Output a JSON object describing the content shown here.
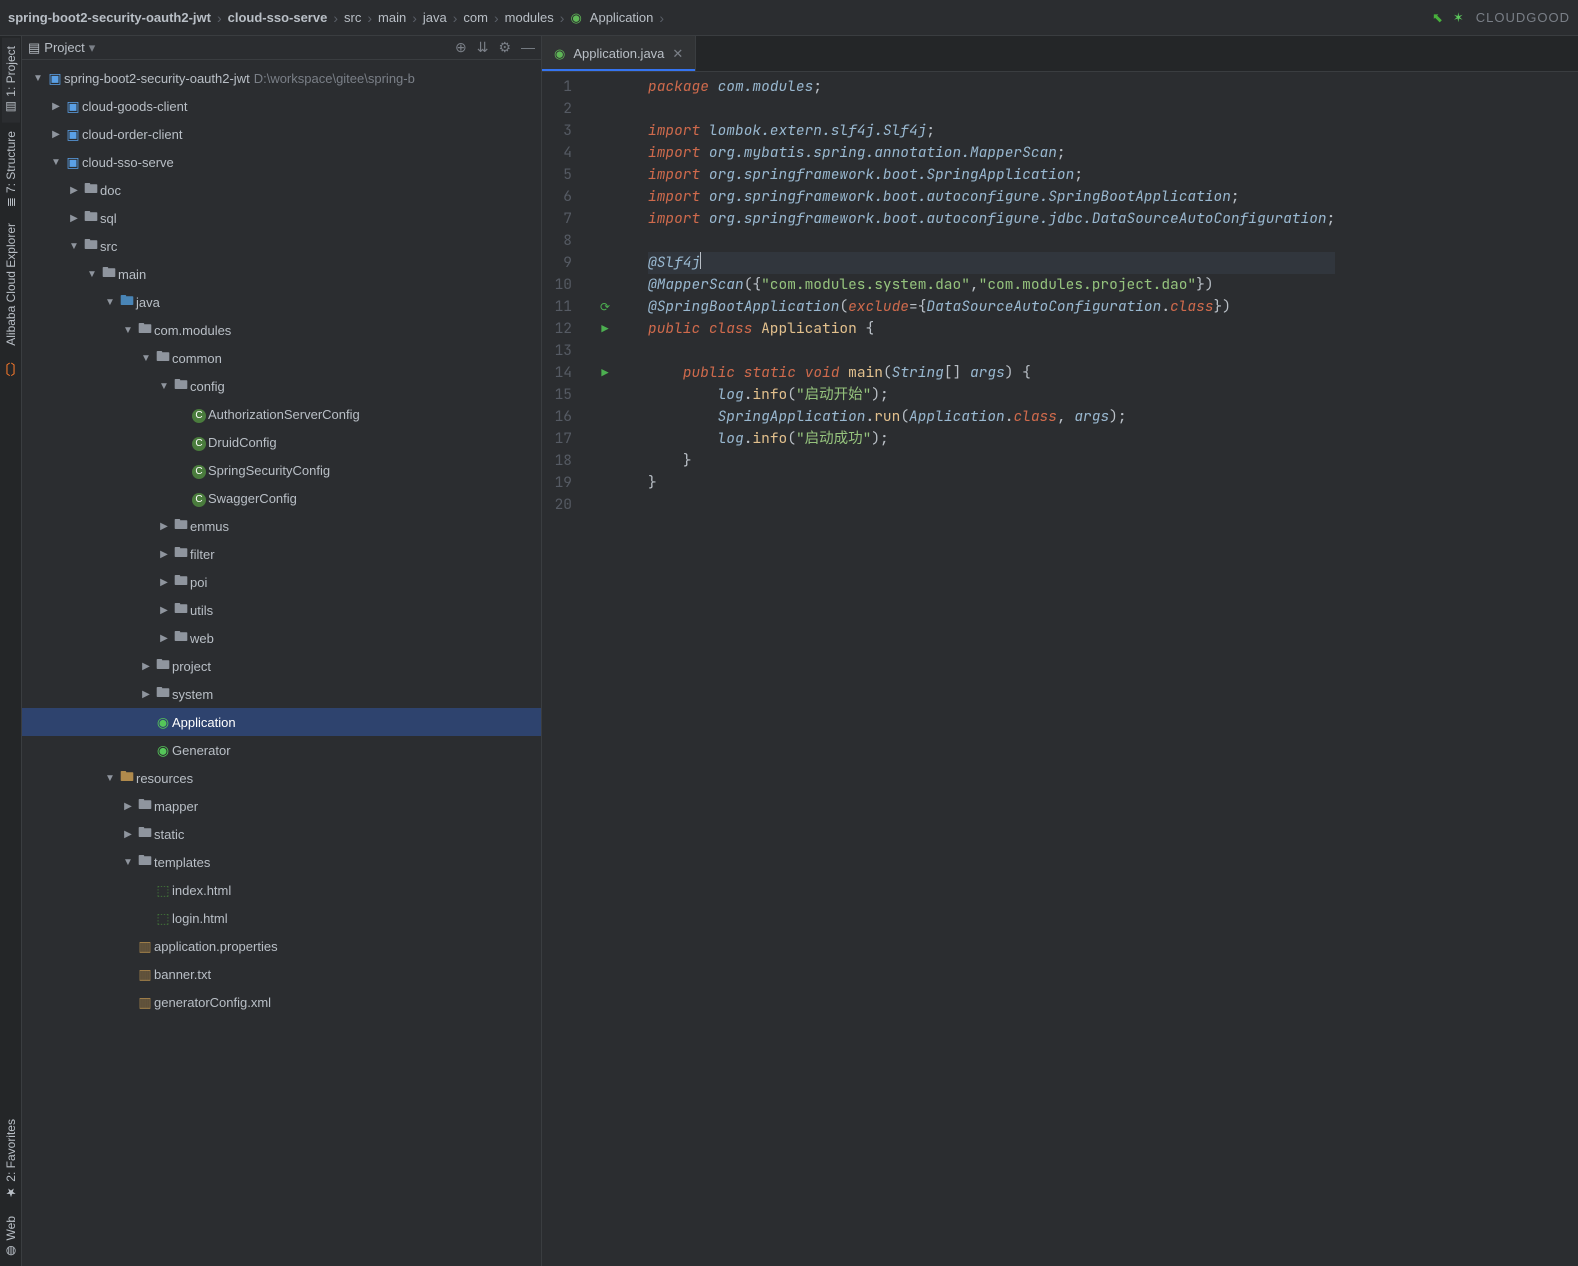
{
  "topRight": {
    "cloud": "CLOUDGOOD"
  },
  "breadcrumbs": [
    {
      "label": "spring-boot2-security-oauth2-jwt",
      "bold": true
    },
    {
      "label": "cloud-sso-serve",
      "bold": true
    },
    {
      "label": "src"
    },
    {
      "label": "main"
    },
    {
      "label": "java"
    },
    {
      "label": "com"
    },
    {
      "label": "modules"
    },
    {
      "label": "Application",
      "icon": "class"
    }
  ],
  "leftViews": {
    "project": "1: Project",
    "structure": "7: Structure",
    "alibaba": "Alibaba Cloud Explorer",
    "favorites": "2: Favorites",
    "web": "Web"
  },
  "projectPane": {
    "title": "Project",
    "root": {
      "label": "spring-boot2-security-oauth2-jwt",
      "path": "D:\\workspace\\gitee\\spring-b"
    }
  },
  "tree": [
    {
      "d": 0,
      "twisty": "▼",
      "icon": "module",
      "label": "spring-boot2-security-oauth2-jwt",
      "suffix": "D:\\workspace\\gitee\\spring-b"
    },
    {
      "d": 1,
      "twisty": "▶",
      "icon": "module",
      "label": "cloud-goods-client"
    },
    {
      "d": 1,
      "twisty": "▶",
      "icon": "module",
      "label": "cloud-order-client"
    },
    {
      "d": 1,
      "twisty": "▼",
      "icon": "module",
      "label": "cloud-sso-serve"
    },
    {
      "d": 2,
      "twisty": "▶",
      "icon": "folder",
      "label": "doc"
    },
    {
      "d": 2,
      "twisty": "▶",
      "icon": "folder",
      "label": "sql"
    },
    {
      "d": 2,
      "twisty": "▼",
      "icon": "folder",
      "label": "src"
    },
    {
      "d": 3,
      "twisty": "▼",
      "icon": "folder",
      "label": "main"
    },
    {
      "d": 4,
      "twisty": "▼",
      "icon": "src",
      "label": "java"
    },
    {
      "d": 5,
      "twisty": "▼",
      "icon": "folder",
      "label": "com.modules"
    },
    {
      "d": 6,
      "twisty": "▼",
      "icon": "folder",
      "label": "common"
    },
    {
      "d": 7,
      "twisty": "▼",
      "icon": "folder",
      "label": "config"
    },
    {
      "d": 8,
      "twisty": "",
      "icon": "class",
      "label": "AuthorizationServerConfig"
    },
    {
      "d": 8,
      "twisty": "",
      "icon": "class",
      "label": "DruidConfig"
    },
    {
      "d": 8,
      "twisty": "",
      "icon": "class",
      "label": "SpringSecurityConfig"
    },
    {
      "d": 8,
      "twisty": "",
      "icon": "class",
      "label": "SwaggerConfig"
    },
    {
      "d": 7,
      "twisty": "▶",
      "icon": "folder",
      "label": "enmus"
    },
    {
      "d": 7,
      "twisty": "▶",
      "icon": "folder",
      "label": "filter"
    },
    {
      "d": 7,
      "twisty": "▶",
      "icon": "folder",
      "label": "poi"
    },
    {
      "d": 7,
      "twisty": "▶",
      "icon": "folder",
      "label": "utils"
    },
    {
      "d": 7,
      "twisty": "▶",
      "icon": "folder",
      "label": "web"
    },
    {
      "d": 6,
      "twisty": "▶",
      "icon": "folder",
      "label": "project"
    },
    {
      "d": 6,
      "twisty": "▶",
      "icon": "folder",
      "label": "system"
    },
    {
      "d": 6,
      "twisty": "",
      "icon": "app",
      "label": "Application",
      "selected": true
    },
    {
      "d": 6,
      "twisty": "",
      "icon": "app",
      "label": "Generator"
    },
    {
      "d": 4,
      "twisty": "▼",
      "icon": "res",
      "label": "resources"
    },
    {
      "d": 5,
      "twisty": "▶",
      "icon": "folder",
      "label": "mapper"
    },
    {
      "d": 5,
      "twisty": "▶",
      "icon": "folder",
      "label": "static"
    },
    {
      "d": 5,
      "twisty": "▼",
      "icon": "folder",
      "label": "templates"
    },
    {
      "d": 6,
      "twisty": "",
      "icon": "html",
      "label": "index.html"
    },
    {
      "d": 6,
      "twisty": "",
      "icon": "html",
      "label": "login.html"
    },
    {
      "d": 5,
      "twisty": "",
      "icon": "prop",
      "label": "application.properties"
    },
    {
      "d": 5,
      "twisty": "",
      "icon": "prop",
      "label": "banner.txt"
    },
    {
      "d": 5,
      "twisty": "",
      "icon": "prop",
      "label": "generatorConfig.xml"
    }
  ],
  "editor": {
    "tab": {
      "label": "Application.java"
    },
    "code": {
      "lines": [
        {
          "n": 1,
          "text": "package com.modules;",
          "type": "pkg"
        },
        {
          "n": 2,
          "text": ""
        },
        {
          "n": 3,
          "text": "import lombok.extern.slf4j.Slf4j;"
        },
        {
          "n": 4,
          "text": "import org.mybatis.spring.annotation.MapperScan;"
        },
        {
          "n": 5,
          "text": "import org.springframework.boot.SpringApplication;"
        },
        {
          "n": 6,
          "text": "import org.springframework.boot.autoconfigure.SpringBootApplication;"
        },
        {
          "n": 7,
          "text": "import org.springframework.boot.autoconfigure.jdbc.DataSourceAutoConfiguration;"
        },
        {
          "n": 8,
          "text": ""
        },
        {
          "n": 9,
          "text": "@Slf4j",
          "current": true
        },
        {
          "n": 10,
          "text": "@MapperScan({\"com.modules.system.dao\",\"com.modules.project.dao\"})"
        },
        {
          "n": 11,
          "text": "@SpringBootApplication(exclude={DataSourceAutoConfiguration.class})"
        },
        {
          "n": 12,
          "text": "public class Application {"
        },
        {
          "n": 13,
          "text": ""
        },
        {
          "n": 14,
          "text": "    public static void main(String[] args) {"
        },
        {
          "n": 15,
          "text": "        log.info(\"启动开始\");"
        },
        {
          "n": 16,
          "text": "        SpringApplication.run(Application.class, args);"
        },
        {
          "n": 17,
          "text": "        log.info(\"启动成功\");"
        },
        {
          "n": 18,
          "text": "    }"
        },
        {
          "n": 19,
          "text": "}"
        },
        {
          "n": 20,
          "text": ""
        }
      ],
      "gutterMarks": {
        "11": "shield",
        "12": "run",
        "14": "run"
      }
    }
  }
}
